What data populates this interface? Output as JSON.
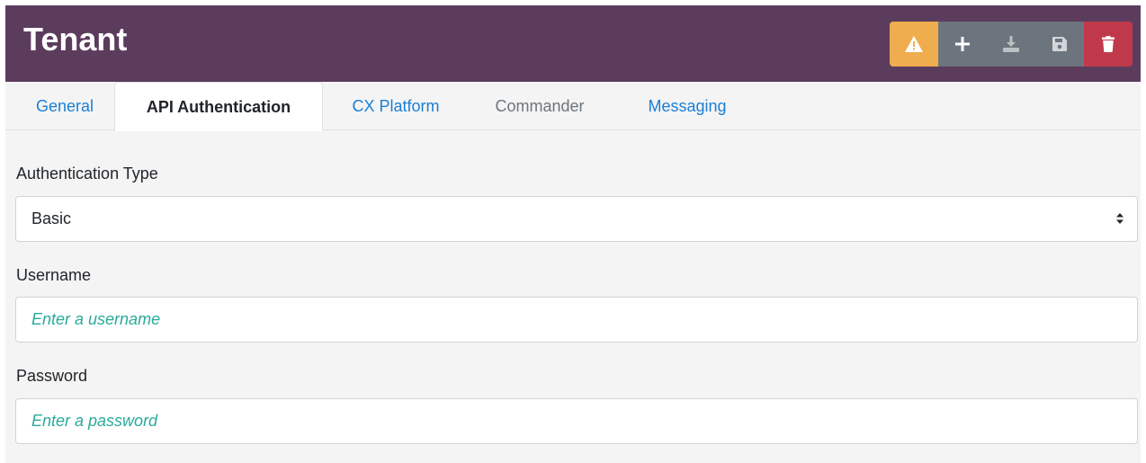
{
  "header": {
    "title": "Tenant",
    "colors": {
      "background": "#5c3c5c",
      "warning": "#f0ad4e",
      "secondary": "#6c757d",
      "danger": "#c0394b"
    },
    "toolbar": [
      {
        "icon": "warning-icon",
        "color": "#f0ad4e"
      },
      {
        "icon": "plus-icon",
        "color": "#6c757d"
      },
      {
        "icon": "download-icon",
        "color": "#6c757d"
      },
      {
        "icon": "save-icon",
        "color": "#6c757d"
      },
      {
        "icon": "trash-icon",
        "color": "#c0394b"
      }
    ]
  },
  "tabs": [
    {
      "label": "General",
      "state": "link"
    },
    {
      "label": "API Authentication",
      "state": "active"
    },
    {
      "label": "CX Platform",
      "state": "link"
    },
    {
      "label": "Commander",
      "state": "disabled"
    },
    {
      "label": "Messaging",
      "state": "link"
    }
  ],
  "form": {
    "auth_type_label": "Authentication Type",
    "auth_type_value": "Basic",
    "username_label": "Username",
    "username_placeholder": "Enter a username",
    "password_label": "Password",
    "password_placeholder": "Enter a password"
  }
}
